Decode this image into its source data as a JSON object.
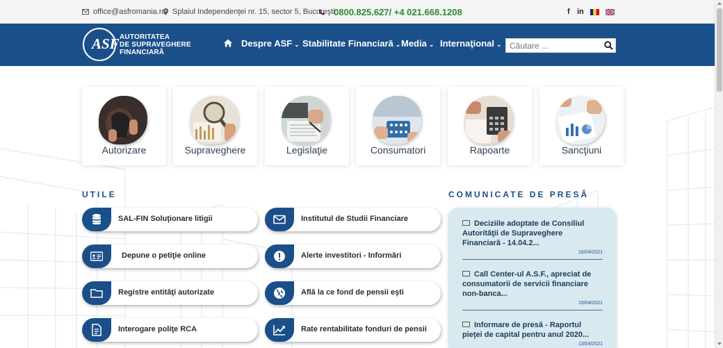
{
  "topbar": {
    "email": "office@asfromania.ro",
    "address": "Splaiul Independenţei nr. 15, sector 5, Bucureşti",
    "phone": "0800.825.627/ +4 021.668.1208",
    "social": {
      "facebook": "f",
      "linkedin": "in"
    }
  },
  "header": {
    "logo_mark": "ASF",
    "logo_lines": [
      "AUTORITATEA",
      "DE SUPRAVEGHERE",
      "FINANCIARĂ"
    ],
    "nav": [
      "Despre ASF",
      "Stabilitate Financiară",
      "Media",
      "Internaţional"
    ],
    "search_placeholder": "Căutare ..."
  },
  "categories": [
    "Autorizare",
    "Supraveghere",
    "Legislaţie",
    "Consumatori",
    "Rapoarte",
    "Sancţiuni"
  ],
  "utile": {
    "title": "UTILE",
    "items": [
      {
        "label": "SAL-FIN Soluţionare litigii",
        "icon": "database-icon"
      },
      {
        "label": "Institutul de Studii Financiare",
        "icon": "envelope-icon"
      },
      {
        "label": "Depune o petiţie online",
        "icon": "id-card-icon"
      },
      {
        "label": "Alerte investitori - Informări",
        "icon": "exclamation-icon"
      },
      {
        "label": "Registre entităţi autorizate",
        "icon": "folder-icon"
      },
      {
        "label": "Află la ce fond de pensii eşti",
        "icon": "globe-icon"
      },
      {
        "label": "Interogare poliţe RCA",
        "icon": "document-icon"
      },
      {
        "label": "Rate rentabilitate fonduri de pensii",
        "icon": "line-chart-icon"
      }
    ]
  },
  "press": {
    "title": "COMUNICATE DE PRESĂ",
    "items": [
      {
        "title": "Deciziile adoptate de Consiliul Autorităţii de Supraveghere Financiară - 14.04.2...",
        "date": "16/04/2021"
      },
      {
        "title": "Call Center-ul A.S.F., apreciat de consumatorii de servicii financiare non-banca...",
        "date": "15/04/2021"
      },
      {
        "title": "Informare de presă - Raportul pieţei de capital pentru anul 2020...",
        "date": "13/04/2021"
      }
    ]
  },
  "colors": {
    "brand_blue": "#1a4f8a",
    "phone_green": "#2e8b2e",
    "press_bg": "#d8eaf0"
  }
}
